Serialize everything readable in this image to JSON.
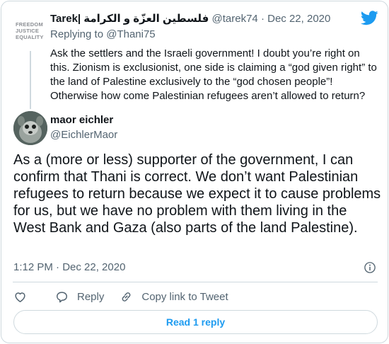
{
  "parent_tweet": {
    "avatar_logo_lines": [
      "FREEDOM",
      "JUSTICE",
      "EQUALITY"
    ],
    "name": "Tarek| فلسطين العزّة و الكرامة",
    "handle": "@tarek74",
    "separator": "·",
    "date": "Dec 22, 2020",
    "reply_prefix": "Replying to ",
    "reply_to": "@Thani75",
    "text": "Ask the settlers and the Israeli government! I doubt you’re right on this. Zionism is exclusionist, one side is claiming a “god given right” to the land of Palestine exclusively to the “god chosen people”! Otherwise how come Palestinian refugees aren’t allowed to return?"
  },
  "main_tweet": {
    "name": "maor eichler",
    "handle": "@EichlerMaor",
    "text": "As a (more or less) supporter of the government, I can confirm that Thani is correct. We don’t want Palestinian refugees to return because we expect it to cause problems for us, but we have no problem with them living in the West Bank and Gaza (also parts of the land Palestine).",
    "timestamp": "1:12 PM · Dec 22, 2020"
  },
  "actions": {
    "like_icon": "heart-icon",
    "reply_label": "Reply",
    "reply_icon": "speech-bubble-icon",
    "copy_label": "Copy link to Tweet",
    "copy_icon": "link-icon"
  },
  "read_replies_label": "Read 1 reply",
  "colors": {
    "brand_blue": "#1d9bf0",
    "text_primary": "#0f1419",
    "text_secondary": "#536471",
    "border": "#cfd9de"
  }
}
